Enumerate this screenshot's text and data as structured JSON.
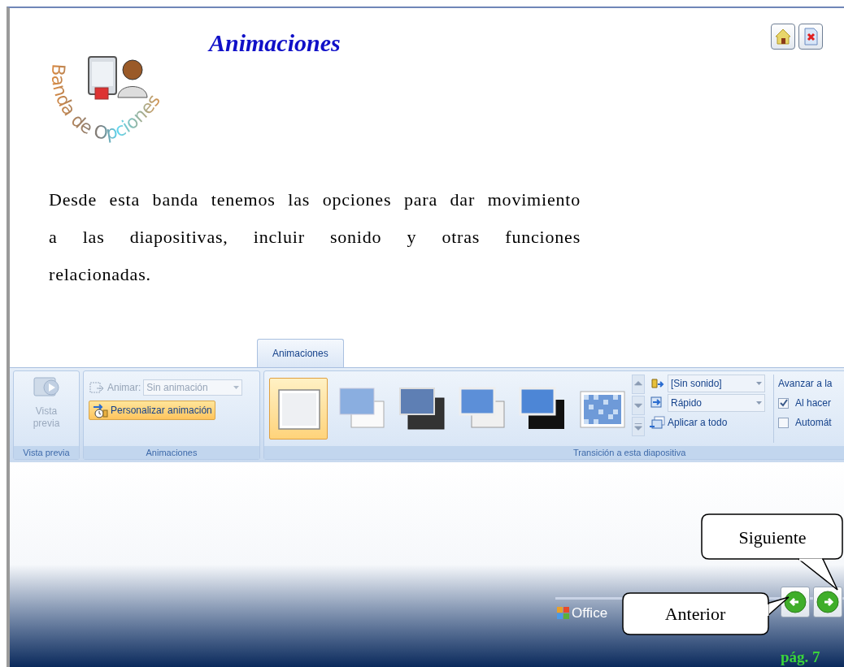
{
  "header": {
    "title": "Animaciones",
    "logo_text": "Banda de Opciones"
  },
  "corner_buttons": [
    {
      "kind": "home"
    },
    {
      "kind": "close"
    }
  ],
  "paragraph": "Desde esta banda tenemos las opciones para dar movimiento a las diapositivas, incluir sonido y otras funciones relacionadas.",
  "ribbon": {
    "tabs": [
      {
        "label": "Animaciones",
        "selected": true
      }
    ],
    "preview_group": {
      "button": "Vista previa",
      "disabled": true,
      "label": "Vista previa"
    },
    "animations_group": {
      "animate_label": "Animar:",
      "animate_value": "Sin animación",
      "disabled": true,
      "custom_button": "Personalizar animación",
      "label": "Animaciones"
    },
    "transition_group": {
      "label": "Transición a esta diapositiva",
      "transitions": [
        {
          "kind": "plain",
          "selected": true
        },
        {
          "kind": "fade",
          "selected": false
        },
        {
          "kind": "dark",
          "selected": false
        },
        {
          "kind": "push",
          "selected": false
        },
        {
          "kind": "cover",
          "selected": false
        },
        {
          "kind": "dissolve",
          "selected": false
        }
      ],
      "sound": "[Sin sonido]",
      "speed": "Rápido",
      "apply_all": "Aplicar a todo"
    },
    "advance_group": {
      "heading": "Avanzar a la",
      "options": [
        {
          "label": "Al hacer",
          "checked": true
        },
        {
          "label": "Automát",
          "checked": false
        }
      ]
    }
  },
  "footer": {
    "brand": "Office",
    "nav_buttons": [
      {
        "kind": "previous"
      },
      {
        "kind": "next"
      }
    ],
    "page": "pág. 7"
  },
  "callouts": [
    {
      "text": "Siguiente",
      "kind": "next"
    },
    {
      "text": "Anterior",
      "kind": "previous"
    }
  ]
}
